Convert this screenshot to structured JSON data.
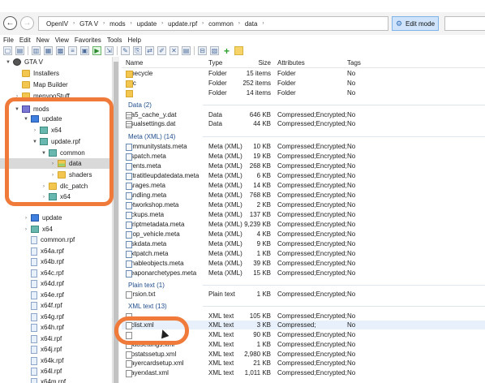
{
  "breadcrumbs": [
    "OpenIV",
    "GTA V",
    "mods",
    "update",
    "update.rpf",
    "common",
    "data"
  ],
  "edit_mode": {
    "label": "Edit mode"
  },
  "menu": [
    "File",
    "Edit",
    "New",
    "View",
    "Favorites",
    "Tools",
    "Help"
  ],
  "tree": [
    {
      "label": "GTA V",
      "icon": "gta",
      "indent": 0,
      "arrow": "▼"
    },
    {
      "label": "Installers",
      "icon": "folder",
      "indent": 1,
      "arrow": ""
    },
    {
      "label": "Map Builder",
      "icon": "folder",
      "indent": 1,
      "arrow": ""
    },
    {
      "label": "menyooStuff",
      "icon": "folder",
      "indent": 1,
      "arrow": "›"
    },
    {
      "label": "mods",
      "icon": "mods",
      "indent": 1,
      "arrow": "▼"
    },
    {
      "label": "update",
      "icon": "update",
      "indent": 2,
      "arrow": "▼"
    },
    {
      "label": "x64",
      "icon": "rpf",
      "indent": 3,
      "arrow": "›"
    },
    {
      "label": "update.rpf",
      "icon": "rpf",
      "indent": 3,
      "arrow": "▼"
    },
    {
      "label": "common",
      "icon": "rpf",
      "indent": 4,
      "arrow": "▼"
    },
    {
      "label": "data",
      "icon": "open",
      "indent": 5,
      "arrow": "›",
      "selected": true
    },
    {
      "label": "shaders",
      "icon": "folder",
      "indent": 5,
      "arrow": "›"
    },
    {
      "label": "dlc_patch",
      "icon": "folder",
      "indent": 4,
      "arrow": "›"
    },
    {
      "label": "x64",
      "icon": "rpf",
      "indent": 4,
      "arrow": "›"
    },
    {
      "label": "",
      "icon": "",
      "indent": 0,
      "arrow": ""
    },
    {
      "label": "update",
      "icon": "update",
      "indent": 2,
      "arrow": "›"
    },
    {
      "label": "x64",
      "icon": "rpf",
      "indent": 2,
      "arrow": "›"
    },
    {
      "label": "common.rpf",
      "icon": "doc",
      "indent": 2,
      "arrow": ""
    },
    {
      "label": "x64a.rpf",
      "icon": "doc",
      "indent": 2,
      "arrow": ""
    },
    {
      "label": "x64b.rpf",
      "icon": "doc",
      "indent": 2,
      "arrow": ""
    },
    {
      "label": "x64c.rpf",
      "icon": "doc",
      "indent": 2,
      "arrow": ""
    },
    {
      "label": "x64d.rpf",
      "icon": "doc",
      "indent": 2,
      "arrow": ""
    },
    {
      "label": "x64e.rpf",
      "icon": "doc",
      "indent": 2,
      "arrow": ""
    },
    {
      "label": "x64f.rpf",
      "icon": "doc",
      "indent": 2,
      "arrow": ""
    },
    {
      "label": "x64g.rpf",
      "icon": "doc",
      "indent": 2,
      "arrow": ""
    },
    {
      "label": "x64h.rpf",
      "icon": "doc",
      "indent": 2,
      "arrow": ""
    },
    {
      "label": "x64i.rpf",
      "icon": "doc",
      "indent": 2,
      "arrow": ""
    },
    {
      "label": "x64j.rpf",
      "icon": "doc",
      "indent": 2,
      "arrow": ""
    },
    {
      "label": "x64k.rpf",
      "icon": "doc",
      "indent": 2,
      "arrow": ""
    },
    {
      "label": "x64l.rpf",
      "icon": "doc",
      "indent": 2,
      "arrow": ""
    },
    {
      "label": "x64m.rpf",
      "icon": "doc",
      "indent": 2,
      "arrow": ""
    }
  ],
  "columns": [
    "Name",
    "Type",
    "Size",
    "Attributes",
    "Tags"
  ],
  "list": [
    {
      "kind": "row",
      "icon": "folder",
      "name": "timecycle",
      "type": "Folder",
      "size": "15 items",
      "attrs": "Folder",
      "tags": "No"
    },
    {
      "kind": "row",
      "icon": "folder",
      "name": "ugc",
      "type": "Folder",
      "size": "252 items",
      "attrs": "Folder",
      "tags": "No"
    },
    {
      "kind": "row",
      "icon": "folder",
      "name": "ui",
      "type": "Folder",
      "size": "14 items",
      "attrs": "Folder",
      "tags": "No"
    },
    {
      "kind": "group",
      "label": "Data (2)"
    },
    {
      "kind": "row",
      "icon": "dat",
      "name": "gta5_cache_y.dat",
      "type": "Data",
      "size": "646 KB",
      "attrs": "Compressed;Encrypted;",
      "tags": "No"
    },
    {
      "kind": "row",
      "icon": "dat",
      "name": "visualsettings.dat",
      "type": "Data",
      "size": "44 KB",
      "attrs": "Compressed;Encrypted;",
      "tags": "No"
    },
    {
      "kind": "group",
      "label": "Meta (XML) (14)"
    },
    {
      "kind": "row",
      "icon": "meta",
      "name": "communitystats.meta",
      "type": "Meta (XML)",
      "size": "10 KB",
      "attrs": "Compressed;Encrypted;",
      "tags": "No"
    },
    {
      "kind": "row",
      "icon": "meta",
      "name": "dispatch.meta",
      "type": "Meta (XML)",
      "size": "19 KB",
      "attrs": "Compressed;Encrypted;",
      "tags": "No"
    },
    {
      "kind": "row",
      "icon": "meta",
      "name": "events.meta",
      "type": "Meta (XML)",
      "size": "268 KB",
      "attrs": "Compressed;Encrypted;",
      "tags": "No"
    },
    {
      "kind": "row",
      "icon": "meta",
      "name": "extratitleupdatedata.meta",
      "type": "Meta (XML)",
      "size": "6 KB",
      "attrs": "Compressed;Encrypted;",
      "tags": "No"
    },
    {
      "kind": "row",
      "icon": "meta",
      "name": "garages.meta",
      "type": "Meta (XML)",
      "size": "14 KB",
      "attrs": "Compressed;Encrypted;",
      "tags": "No"
    },
    {
      "kind": "row",
      "icon": "meta",
      "name": "handling.meta",
      "type": "Meta (XML)",
      "size": "768 KB",
      "attrs": "Compressed;Encrypted;",
      "tags": "No"
    },
    {
      "kind": "row",
      "icon": "meta",
      "name": "networkshop.meta",
      "type": "Meta (XML)",
      "size": "2 KB",
      "attrs": "Compressed;Encrypted;",
      "tags": "No"
    },
    {
      "kind": "row",
      "icon": "meta",
      "name": "pickups.meta",
      "type": "Meta (XML)",
      "size": "137 KB",
      "attrs": "Compressed;Encrypted;",
      "tags": "No"
    },
    {
      "kind": "row",
      "icon": "meta",
      "name": "scriptmetadata.meta",
      "type": "Meta (XML)",
      "size": "9,239 KB",
      "attrs": "Compressed;Encrypted;",
      "tags": "No"
    },
    {
      "kind": "row",
      "icon": "meta",
      "name": "shop_vehicle.meta",
      "type": "Meta (XML)",
      "size": "4 KB",
      "attrs": "Compressed;Encrypted;",
      "tags": "No"
    },
    {
      "kind": "row",
      "icon": "meta",
      "name": "taskdata.meta",
      "type": "Meta (XML)",
      "size": "9 KB",
      "attrs": "Compressed;Encrypted;",
      "tags": "No"
    },
    {
      "kind": "row",
      "icon": "meta",
      "name": "textpatch.meta",
      "type": "Meta (XML)",
      "size": "1 KB",
      "attrs": "Compressed;Encrypted;",
      "tags": "No"
    },
    {
      "kind": "row",
      "icon": "meta",
      "name": "tunableobjects.meta",
      "type": "Meta (XML)",
      "size": "39 KB",
      "attrs": "Compressed;Encrypted;",
      "tags": "No"
    },
    {
      "kind": "row",
      "icon": "meta",
      "name": "weaponarchetypes.meta",
      "type": "Meta (XML)",
      "size": "15 KB",
      "attrs": "Compressed;Encrypted;",
      "tags": "No"
    },
    {
      "kind": "group",
      "label": "Plain text (1)"
    },
    {
      "kind": "row",
      "icon": "doc",
      "name": "version.txt",
      "type": "Plain text",
      "size": "1 KB",
      "attrs": "Compressed;Encrypted;",
      "tags": "No"
    },
    {
      "kind": "group",
      "label": "XML text (13)"
    },
    {
      "kind": "row",
      "icon": "doc",
      "name": "",
      "type": "XML text",
      "size": "105 KB",
      "attrs": "Compressed;Encrypted;",
      "tags": "No"
    },
    {
      "kind": "row",
      "icon": "doc",
      "name": "dlclist.xml",
      "type": "XML text",
      "size": "3 KB",
      "attrs": "Compressed;",
      "tags": "No",
      "hl": true
    },
    {
      "kind": "row",
      "icon": "doc",
      "name": "",
      "type": "XML text",
      "size": "90 KB",
      "attrs": "Compressed;Encrypted;",
      "tags": "No"
    },
    {
      "kind": "row",
      "icon": "doc",
      "name": "hbaosettings.xml",
      "type": "XML text",
      "size": "1 KB",
      "attrs": "Compressed;Encrypted;",
      "tags": "No"
    },
    {
      "kind": "row",
      "icon": "doc",
      "name": "mpstatssetup.xml",
      "type": "XML text",
      "size": "2,980 KB",
      "attrs": "Compressed;Encrypted;",
      "tags": "No"
    },
    {
      "kind": "row",
      "icon": "doc",
      "name": "playercardsetup.xml",
      "type": "XML text",
      "size": "21 KB",
      "attrs": "Compressed;Encrypted;",
      "tags": "No"
    },
    {
      "kind": "row",
      "icon": "doc",
      "name": "playerxlast.xml",
      "type": "XML text",
      "size": "1,011 KB",
      "attrs": "Compressed;Encrypted;",
      "tags": "No"
    }
  ],
  "colors": {
    "highlight_ring": "#f07a3a",
    "selected": "#d9d9d9"
  }
}
